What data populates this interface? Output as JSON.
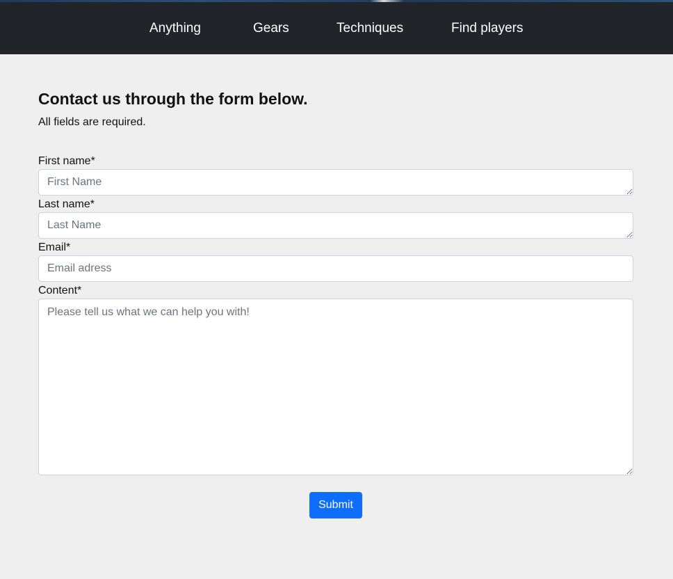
{
  "nav": {
    "items": [
      {
        "label": "Anything"
      },
      {
        "label": "Gears"
      },
      {
        "label": "Techniques"
      },
      {
        "label": "Find players"
      }
    ]
  },
  "main": {
    "heading": "Contact us through the form below.",
    "subtext": "All fields are required."
  },
  "form": {
    "first_name": {
      "label": "First name*",
      "placeholder": "First Name",
      "value": ""
    },
    "last_name": {
      "label": "Last name*",
      "placeholder": "Last Name",
      "value": ""
    },
    "email": {
      "label": "Email*",
      "placeholder": "Email adress",
      "value": ""
    },
    "content": {
      "label": "Content*",
      "placeholder": "Please tell us what we can help you with!",
      "value": ""
    },
    "submit_label": "Submit"
  },
  "colors": {
    "navbar_bg": "#212529",
    "page_bg": "#efefef",
    "button_primary": "#0d6efd"
  }
}
